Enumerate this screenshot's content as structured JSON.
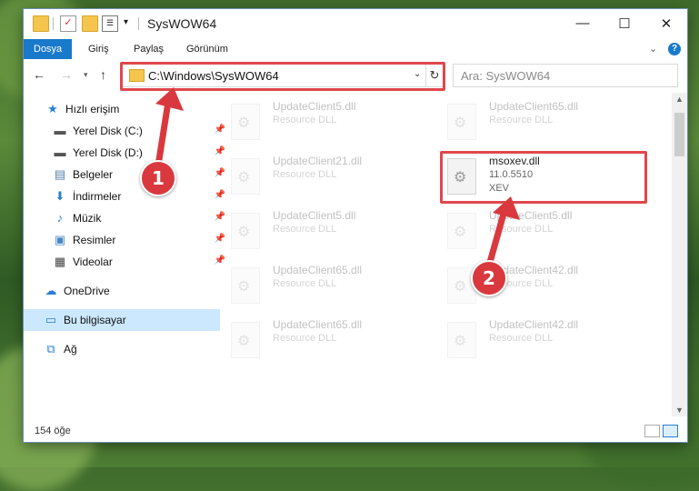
{
  "window": {
    "title": "SysWOW64",
    "controls": {
      "minimize": "—",
      "maximize": "☐",
      "close": "✕"
    }
  },
  "ribbon": {
    "tabs": [
      {
        "label": "Dosya",
        "active": true
      },
      {
        "label": "Giriş"
      },
      {
        "label": "Paylaş"
      },
      {
        "label": "Görünüm"
      }
    ],
    "collapse_glyph": "⌄",
    "help_glyph": "?"
  },
  "address": {
    "path": "C:\\Windows\\SysWOW64",
    "search_placeholder": "Ara: SysWOW64"
  },
  "nav": {
    "quick_access": "Hızlı erişim",
    "items": [
      {
        "label": "Yerel Disk (C:)",
        "icon": "drive-icon"
      },
      {
        "label": "Yerel Disk (D:)",
        "icon": "drive-icon"
      },
      {
        "label": "Belgeler",
        "icon": "documents-icon"
      },
      {
        "label": "İndirmeler",
        "icon": "download-icon"
      },
      {
        "label": "Müzik",
        "icon": "music-icon"
      },
      {
        "label": "Resimler",
        "icon": "pictures-icon"
      },
      {
        "label": "Videolar",
        "icon": "video-icon"
      }
    ],
    "onedrive": "OneDrive",
    "this_pc": "Bu bilgisayar",
    "network": "Ağ"
  },
  "files": [
    {
      "name": "UpdateClient5.dll",
      "sub": "Resource DLL",
      "faded": true
    },
    {
      "name": "UpdateClient65.dll",
      "sub": "Resource DLL",
      "faded": true
    },
    {
      "name": "UpdateClient21.dll",
      "sub": "Resource DLL",
      "faded": true
    },
    {
      "name": "msoxev.dll",
      "sub": "11.0.5510",
      "sub2": "XEV",
      "faded": false
    },
    {
      "name": "UpdateClient5.dll",
      "sub": "Resource DLL",
      "faded": true
    },
    {
      "name": "UpdateClient5.dll",
      "sub": "Resource DLL",
      "faded": true
    },
    {
      "name": "UpdateClient65.dll",
      "sub": "Resource DLL",
      "faded": true
    },
    {
      "name": "UpdateClient42.dll",
      "sub": "Resource DLL",
      "faded": true
    },
    {
      "name": "UpdateClient65.dll",
      "sub": "Resource DLL",
      "faded": true
    },
    {
      "name": "UpdateClient42.dll",
      "sub": "Resource DLL",
      "faded": true
    }
  ],
  "status": {
    "count": "154 öğe"
  },
  "annotations": {
    "step1": "1",
    "step2": "2",
    "color": "#d9393e"
  }
}
